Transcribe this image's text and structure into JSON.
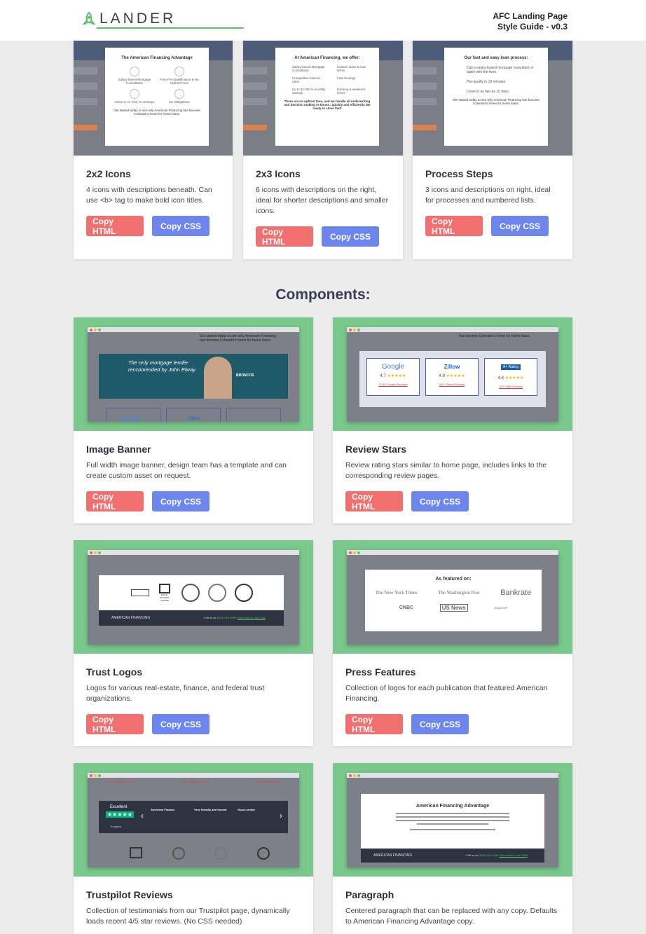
{
  "header": {
    "logo_text": "LANDER",
    "doc_title_line1": "AFC Landing Page",
    "doc_title_line2": "Style Guide - v0.3"
  },
  "colors": {
    "copy_html": "#f26f6f",
    "copy_css": "#6d86ee",
    "preview_green": "#7ac98c",
    "brand_green": "#5bbf6a"
  },
  "buttons": {
    "copy_html": "Copy HTML",
    "copy_css": "Copy CSS"
  },
  "top_cards": [
    {
      "title": "2x2 Icons",
      "description": "4 icons with descriptions beneath. Can use <b> tag to make bold icon titles.",
      "preview": {
        "heading": "The American Financing Advantage",
        "items": [
          "Salary-based Mortgage Consultants",
          "Free Pre-Qualification & No Upfront Fees",
          "Close In As Fast As 10 Days",
          "No Obligations"
        ],
        "footer": "Get started today to see why American Financing has become Colorado's home for home loans."
      }
    },
    {
      "title": "2x3 Icons",
      "description": "6 icons with descriptions on the right, ideal for shorter descriptions and smaller icons.",
      "preview": {
        "heading": "At American Financing, we offer:",
        "items": [
          "Salary-based Mortgage Consultants",
          "Custom loans & loan terms",
          "Competitive interest rates",
          "Fast closings",
          "Up to $1,000 in monthly savings",
          "Evening & weekend hours"
        ],
        "footer": "There are no upfront fees, and we handle all underwriting and decision making in-house...quickly and efficiently. Be ready to close fast!"
      }
    },
    {
      "title": "Process Steps",
      "description": "3 icons and descriptions on right, ideal for processes and numbered lists.",
      "preview": {
        "heading": "Our fast and easy loan process:",
        "items": [
          "Call a salary-based mortgage consultant or apply with the form.",
          "Pre-qualify in 10 minutes.",
          "Close in as fast as 10 days."
        ],
        "footer": "Get started today to see why American Financing has become Colorado's home for home loans."
      }
    }
  ],
  "section_title": "Components:",
  "components": [
    {
      "title": "Image Banner",
      "description": "Full width image banner, design team has a template and can create custom asset on request.",
      "preview": {
        "banner_line1": "The only mortgage lender",
        "banner_line2": "reccomended by John Elway.",
        "top_text": "Get started today to see why American Financing has become Colorado's home for home loans.",
        "team": "BRONCOS",
        "logos": [
          "Google",
          "Zillow"
        ]
      }
    },
    {
      "title": "Review Stars",
      "description": "Review rating stars similar to home page, includes links to the corresponding review pages.",
      "preview": {
        "top_text": "has become Colorado's home for home loans.",
        "reviews": [
          {
            "brand": "Google",
            "score": "4.7",
            "link": "1700+ Google Reviews"
          },
          {
            "brand": "Zillow",
            "score": "4.9",
            "link": "600+ Zillow Reviews"
          },
          {
            "brand": "A+ Rating",
            "score": "4.8",
            "link": "100+ BBB Reviews"
          }
        ]
      }
    },
    {
      "title": "Trust Logos",
      "description": "Logos for various real-estate, finance, and federal trust organizations.",
      "preview": {
        "logos": [
          "EQUAL HOUSING LENDER"
        ],
        "brand": "AMERICAN FINANCING",
        "call_label": "Call us at:",
        "phone": "(800) 910-4055",
        "chat": "Click here to Live Chat"
      }
    },
    {
      "title": "Press Features",
      "description": "Collection of logos for each publication that featured American Financing.",
      "preview": {
        "heading": "As featured on:",
        "logos": [
          "The New York Times",
          "The Washington Post",
          "Bankrate",
          "CNBC",
          "US News",
          "REALTOR"
        ]
      }
    },
    {
      "title": "Trustpilot Reviews",
      "description": "Collection of testimonials from our Trustpilot page, dynamically loads recent 4/5 star reviews. (No CSS needed)",
      "preview": {
        "rating_word": "Excellent",
        "links": [
          "1700+ Google Reviews",
          "600+ Zillow Reviews",
          "100+ BBB Reviews"
        ],
        "review_titles": [
          "American Finance",
          "Very friendly and honest",
          "Good Lender"
        ],
        "brand": "Trustpilot"
      }
    },
    {
      "title": "Paragraph",
      "description": "Centered paragraph that can be replaced with any copy. Defaults to American Financing Advantage copy.",
      "preview": {
        "heading": "American Financing Advantage",
        "brand": "AMERICAN FINANCING",
        "call_label": "Call us at:",
        "phone": "(800) 910-4055",
        "chat": "Click here to Live Chat"
      }
    }
  ]
}
